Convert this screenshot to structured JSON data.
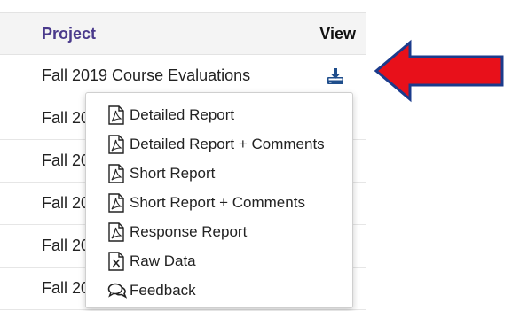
{
  "table": {
    "header": {
      "project": "Project",
      "view": "View"
    },
    "rows": [
      {
        "project": "Fall 2019 Course Evaluations"
      },
      {
        "project": "Fall 20"
      },
      {
        "project": "Fall 20"
      },
      {
        "project": "Fall 20"
      },
      {
        "project": "Fall 20"
      },
      {
        "project": "Fall 20"
      }
    ]
  },
  "menu": {
    "items": [
      {
        "label": "Detailed Report",
        "icon": "pdf-icon"
      },
      {
        "label": "Detailed Report + Comments",
        "icon": "pdf-icon"
      },
      {
        "label": "Short Report",
        "icon": "pdf-icon"
      },
      {
        "label": "Short Report + Comments",
        "icon": "pdf-icon"
      },
      {
        "label": "Response Report",
        "icon": "pdf-icon"
      },
      {
        "label": "Raw Data",
        "icon": "excel-icon"
      },
      {
        "label": "Feedback",
        "icon": "comments-icon"
      }
    ]
  },
  "colors": {
    "header_text": "#4a3a8c",
    "download_icon": "#1f4e8c",
    "arrow_fill": "#e8101a",
    "arrow_stroke": "#1b3b8c"
  }
}
